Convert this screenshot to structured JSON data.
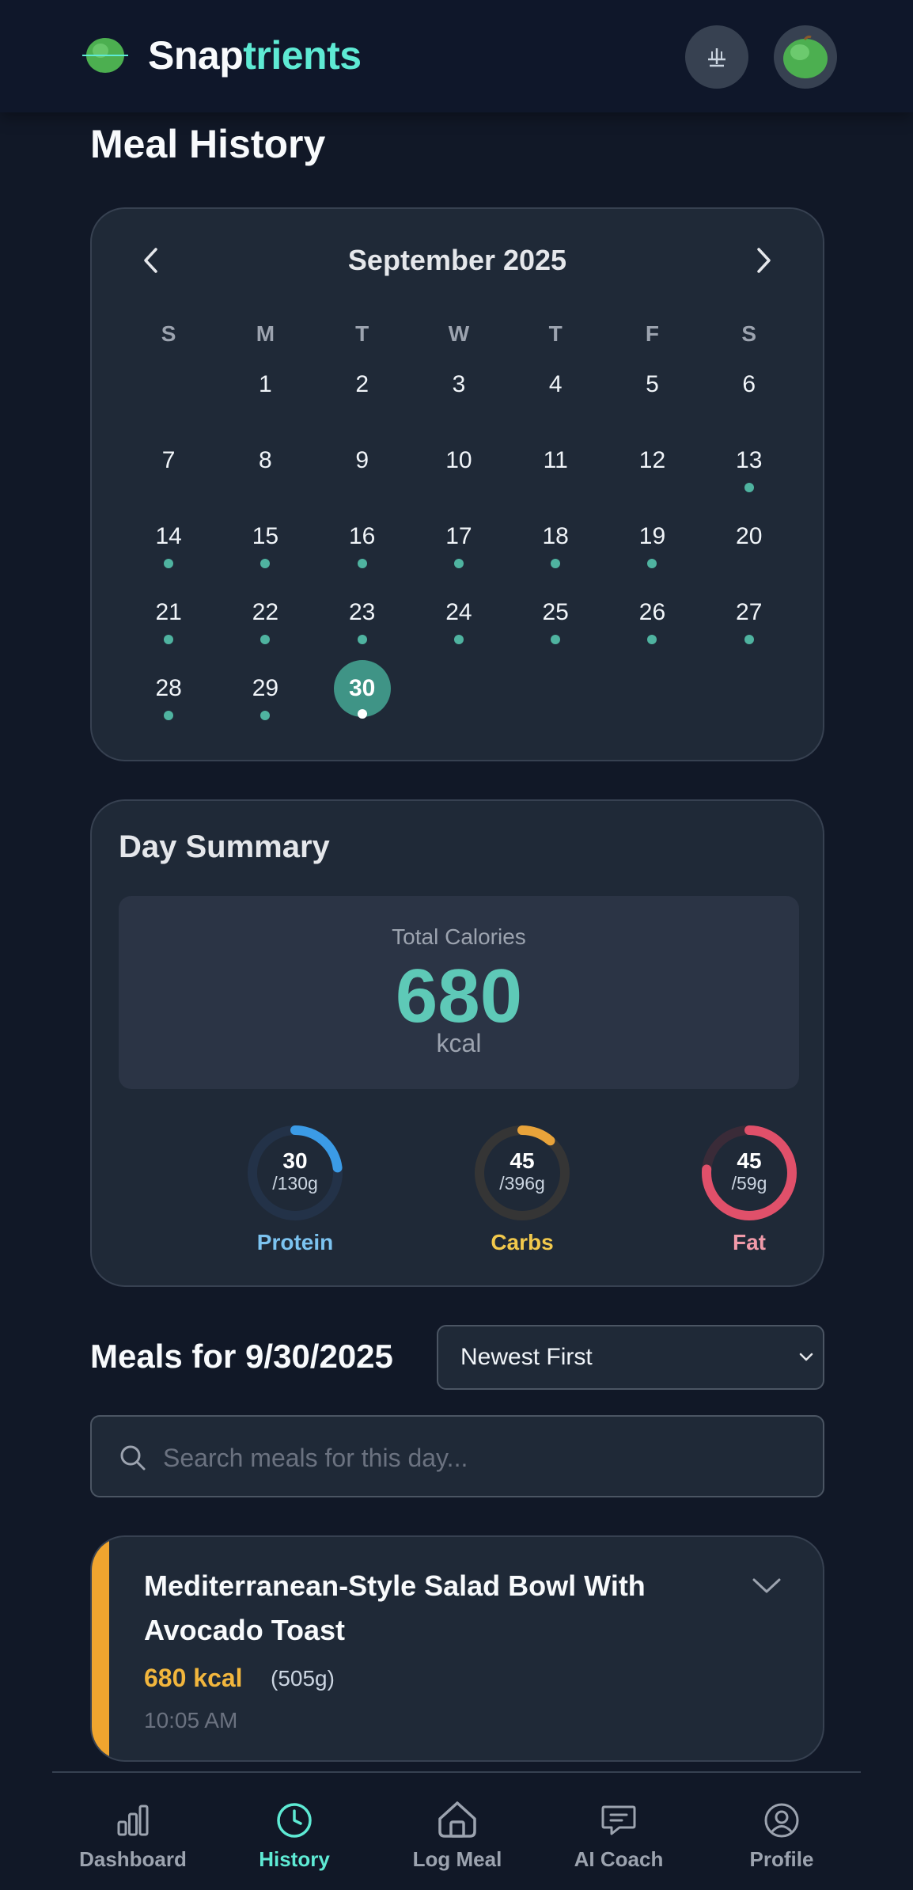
{
  "header": {
    "brand_part1": "Snap",
    "brand_part2": "trients",
    "colors": {
      "brand_white": "#f8fafc",
      "brand_teal": "#5eead4",
      "background": "#0f172a"
    }
  },
  "page": {
    "title": "Meal History"
  },
  "calendar": {
    "month_label": "September 2025",
    "weekdays": [
      "S",
      "M",
      "T",
      "W",
      "T",
      "F",
      "S"
    ],
    "weeks": [
      [
        null,
        "1",
        "2",
        "3",
        "4",
        "5",
        "6"
      ],
      [
        "7",
        "8",
        "9",
        "10",
        "11",
        "12",
        "13"
      ],
      [
        "14",
        "15",
        "16",
        "17",
        "18",
        "19",
        "20"
      ],
      [
        "21",
        "22",
        "23",
        "24",
        "25",
        "26",
        "27"
      ],
      [
        "28",
        "29",
        "30",
        null,
        null,
        null,
        null
      ]
    ],
    "days_with_meals": [
      "13",
      "14",
      "15",
      "16",
      "17",
      "18",
      "19",
      "21",
      "22",
      "23",
      "24",
      "25",
      "26",
      "27",
      "28",
      "29",
      "30"
    ],
    "selected_day": "30",
    "colors": {
      "dot": "#4fb3a0",
      "selected": "#3f9486"
    }
  },
  "day_summary": {
    "title": "Day Summary",
    "total_label": "Total Calories",
    "total_value": "680",
    "total_unit": "kcal",
    "macros": [
      {
        "name": "Protein",
        "value": "30",
        "goal": "/130g",
        "fraction": 0.23,
        "color": "#3b9be6",
        "label_color": "#7cc3f0",
        "track": "#233248"
      },
      {
        "name": "Carbs",
        "value": "45",
        "goal": "/396g",
        "fraction": 0.114,
        "color": "#e8a33a",
        "label_color": "#f2c94c",
        "track": "#353535"
      },
      {
        "name": "Fat",
        "value": "45",
        "goal": "/59g",
        "fraction": 0.763,
        "color": "#e0506a",
        "label_color": "#f09aa9",
        "track": "#3a2b38"
      }
    ]
  },
  "meals": {
    "title": "Meals for 9/30/2025",
    "sort_value": "Newest First",
    "search_placeholder": "Search meals for this day...",
    "items": [
      {
        "name": "Mediterranean-Style Salad Bowl With Avocado Toast",
        "calories": "680 kcal",
        "weight": "(505g)",
        "time": "10:05 AM",
        "accent_color": "#f0a52f"
      }
    ]
  },
  "bottom_nav": {
    "active": "History",
    "items": [
      {
        "label": "Dashboard",
        "icon": "bar-chart-icon"
      },
      {
        "label": "History",
        "icon": "clock-icon"
      },
      {
        "label": "Log Meal",
        "icon": "camera-house-icon"
      },
      {
        "label": "AI Coach",
        "icon": "chat-icon"
      },
      {
        "label": "Profile",
        "icon": "user-icon"
      }
    ]
  }
}
